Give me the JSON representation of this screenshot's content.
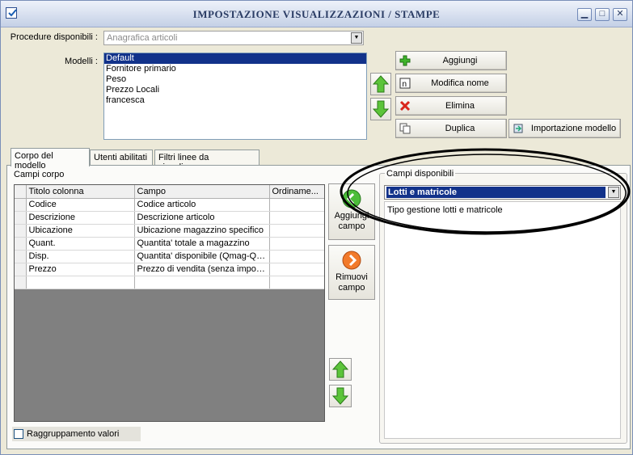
{
  "window": {
    "title": "IMPOSTAZIONE VISUALIZZAZIONI / STAMPE",
    "controls": {
      "minimize": "▁",
      "maximize": "□",
      "close": "✕"
    }
  },
  "procedure": {
    "label": "Procedure disponibili :",
    "value": "Anagrafica articoli"
  },
  "models": {
    "label": "Modelli :",
    "items": [
      "Default",
      "Fornitore primario",
      "Peso",
      "Prezzo Locali",
      "francesca"
    ],
    "selected_index": 0
  },
  "actions": {
    "add": "Aggiungi",
    "rename": "Modifica nome",
    "delete": "Elimina",
    "duplicate": "Duplica",
    "import": "Importazione modello"
  },
  "tabs": [
    "Corpo del modello",
    "Utenti abilitati",
    "Filtri linee da visualizzare"
  ],
  "body_fields": {
    "label": "Campi corpo",
    "columns": [
      "Titolo colonna",
      "Campo",
      "Ordiname..."
    ],
    "rows": [
      [
        "Codice",
        "Codice articolo",
        ""
      ],
      [
        "Descrizione",
        "Descrizione articolo",
        ""
      ],
      [
        "Ubicazione",
        "Ubicazione magazzino specifico",
        ""
      ],
      [
        "Quant.",
        "Quantita' totale a magazzino",
        ""
      ],
      [
        "Disp.",
        "Quantita' disponibile (Qmag-Qo...",
        ""
      ],
      [
        "Prezzo",
        "Prezzo di vendita (senza imposte)",
        ""
      ],
      [
        "",
        "",
        ""
      ]
    ]
  },
  "side_buttons": {
    "add_field": "Aggiungi campo",
    "remove_field": "Rimuovi campo"
  },
  "available": {
    "label": "Campi disponibili",
    "selected": "Lotti e matricole",
    "items": [
      "Tipo gestione lotti e matricole"
    ]
  },
  "grouping": {
    "label": "Raggruppamento valori",
    "checked": false
  },
  "colors": {
    "accent": "#12328a",
    "title_text": "#2a3c64",
    "window_bg": "#ece9d8"
  }
}
